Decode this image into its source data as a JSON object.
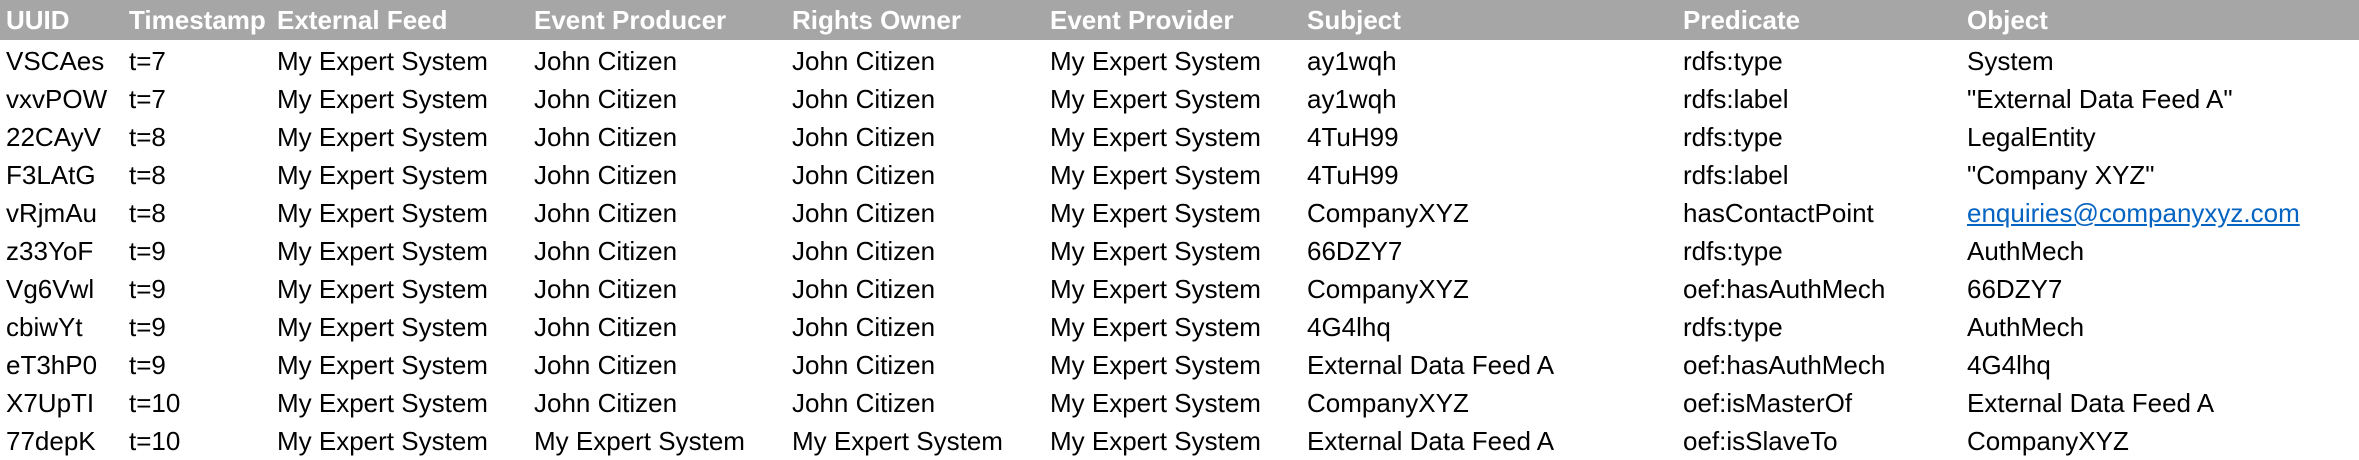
{
  "sheet": {
    "columns": [
      "UUID",
      "Timestamp",
      "External Feed",
      "Event Producer",
      "Rights Owner",
      "Event Provider",
      "Subject",
      "Predicate",
      "Object"
    ],
    "rows": [
      [
        "VSCAes",
        "t=7",
        "My Expert System",
        "John Citizen",
        "John Citizen",
        "My Expert System",
        "ay1wqh",
        "rdfs:type",
        "System"
      ],
      [
        "vxvPOW",
        "t=7",
        "My Expert System",
        "John Citizen",
        "John Citizen",
        "My Expert System",
        "ay1wqh",
        "rdfs:label",
        "\"External Data Feed A\""
      ],
      [
        "22CAyV",
        "t=8",
        "My Expert System",
        "John Citizen",
        "John Citizen",
        "My Expert System",
        "4TuH99",
        "rdfs:type",
        "LegalEntity"
      ],
      [
        "F3LAtG",
        "t=8",
        "My Expert System",
        "John Citizen",
        "John Citizen",
        "My Expert System",
        "4TuH99",
        "rdfs:label",
        "\"Company XYZ\""
      ],
      [
        "vRjmAu",
        "t=8",
        "My Expert System",
        "John Citizen",
        "John Citizen",
        "My Expert System",
        "CompanyXYZ",
        "hasContactPoint",
        "enquiries@companyxyz.com"
      ],
      [
        "z33YoF",
        "t=9",
        "My Expert System",
        "John Citizen",
        "John Citizen",
        "My Expert System",
        "66DZY7",
        "rdfs:type",
        "AuthMech"
      ],
      [
        "Vg6Vwl",
        "t=9",
        "My Expert System",
        "John Citizen",
        "John Citizen",
        "My Expert System",
        "CompanyXYZ",
        "oef:hasAuthMech",
        "66DZY7"
      ],
      [
        "cbiwYt",
        "t=9",
        "My Expert System",
        "John Citizen",
        "John Citizen",
        "My Expert System",
        "4G4lhq",
        "rdfs:type",
        "AuthMech"
      ],
      [
        "eT3hP0",
        "t=9",
        "My Expert System",
        "John Citizen",
        "John Citizen",
        "My Expert System",
        "External Data Feed A",
        "oef:hasAuthMech",
        "4G4lhq"
      ],
      [
        "X7UpTI",
        "t=10",
        "My Expert System",
        "John Citizen",
        "John Citizen",
        "My Expert System",
        "CompanyXYZ",
        "oef:isMasterOf",
        "External Data Feed A"
      ],
      [
        "77depK",
        "t=10",
        "My Expert System",
        "My Expert System",
        "My Expert System",
        "My Expert System",
        "External Data Feed A",
        "oef:isSlaveTo",
        "CompanyXYZ"
      ]
    ]
  },
  "colors": {
    "header_background": "#a6a6a6",
    "header_text": "#ffffff",
    "link": "#0563c1"
  }
}
